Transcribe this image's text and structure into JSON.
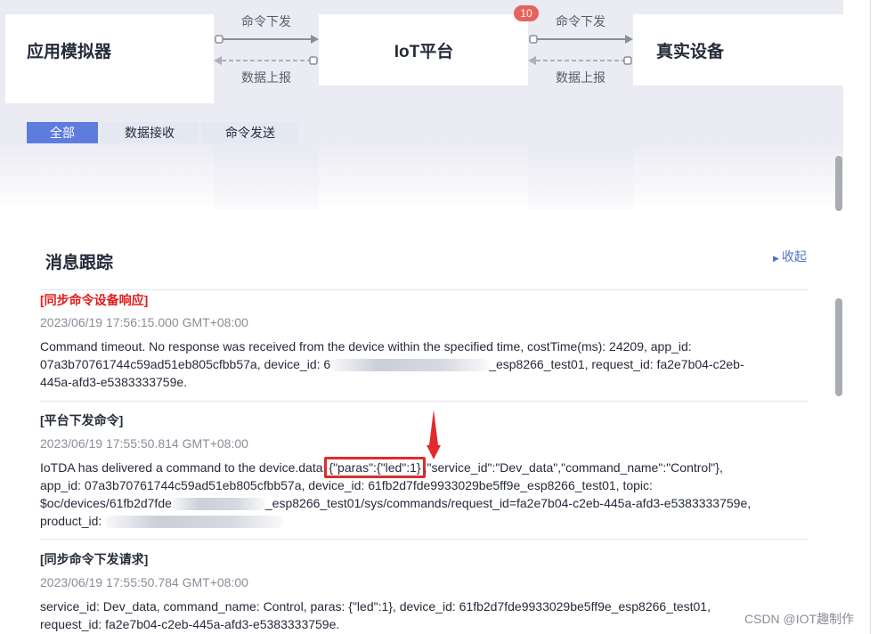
{
  "simulator": {
    "app_title": "应用模拟器",
    "platform_title": "IoT平台",
    "device_title": "真实设备",
    "flow_left": {
      "down_label": "命令下发",
      "up_label": "数据上报"
    },
    "flow_right": {
      "down_label": "命令下发",
      "up_label": "数据上报"
    },
    "badge": "10"
  },
  "tabs": [
    {
      "label": "全部",
      "active": true
    },
    {
      "label": "数据接收",
      "active": false
    },
    {
      "label": "命令发送",
      "active": false
    }
  ],
  "trace": {
    "title": "消息跟踪",
    "collapse_label": "收起",
    "entries": [
      {
        "header": "[同步命令设备响应]",
        "time": "2023/06/19 17:56:15.000 GMT+08:00",
        "line1": "Command timeout. No response was received from the device within the specified time, costTime(ms): 24209, app_id:",
        "line2_a": "07a3b70761744c59ad51eb805cfbb57a, device_id: 6",
        "line2_b": "_esp8266_test01, request_id: fa2e7b04-c2eb-",
        "line3": "445a-afd3-e5383333759e."
      },
      {
        "header": "[平台下发命令]",
        "time": "2023/06/19 17:55:50.814 GMT+08:00",
        "line1_a": "IoTDA has delivered a command to the device.data:",
        "line1_hl": "{\"paras\":{\"led\":1}",
        "line1_b": ",\"service_id\":\"Dev_data\",\"command_name\":\"Control\"},",
        "line2": "app_id: 07a3b70761744c59ad51eb805cfbb57a, device_id: 61fb2d7fde9933029be5ff9e_esp8266_test01, topic:",
        "line3_a": "$oc/devices/61fb2d7fde",
        "line3_b": "_esp8266_test01/sys/commands/request_id=fa2e7b04-c2eb-445a-afd3-e5383333759e,",
        "line4": "product_id:"
      },
      {
        "header": "[同步命令下发请求]",
        "time": "2023/06/19 17:55:50.784 GMT+08:00",
        "line1": "service_id: Dev_data, command_name: Control, paras: {\"led\":1}, device_id: 61fb2d7fde9933029be5ff9e_esp8266_test01,",
        "line2": "request_id: fa2e7b04-c2eb-445a-afd3-e5383333759e."
      }
    ]
  },
  "watermark": "CSDN @IOT趣制作",
  "colors": {
    "accent": "#5e7ce0",
    "highlight": "#e02b2b",
    "badge": "#e7625b",
    "link": "#526ecc"
  }
}
